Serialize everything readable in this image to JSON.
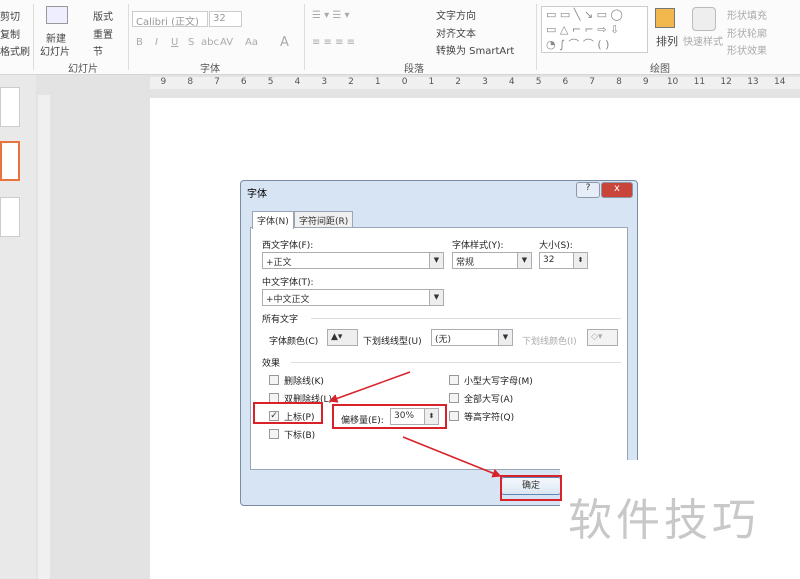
{
  "ribbon": {
    "clipboard": {
      "cut": "剪切",
      "copy": "复制",
      "format_painter": "格式刷"
    },
    "slides": {
      "new_slide": "新建",
      "new_slide2": "幻灯片",
      "layout": "版式",
      "reset": "重置",
      "section": "节",
      "label": "幻灯片"
    },
    "font": {
      "font_name": "Calibri (正文)",
      "font_size": "32",
      "bold": "B",
      "italic": "I",
      "underline": "U",
      "shadow": "S",
      "strike": "abc",
      "spacing": "AV",
      "case": "Aa",
      "color": "A",
      "label": "字体"
    },
    "paragraph": {
      "text_direction": "文字方向",
      "align_text": "对齐文本",
      "convert_smartart": "转换为 SmartArt",
      "label": "段落"
    },
    "drawing": {
      "arrange": "排列",
      "quick_styles": "快速样式",
      "shape_fill": "形状填充",
      "shape_outline": "形状轮廓",
      "shape_effects": "形状效果",
      "label": "绘图"
    }
  },
  "ruler": {
    "ticks": [
      "9",
      "8",
      "7",
      "6",
      "5",
      "4",
      "3",
      "2",
      "1",
      "0",
      "1",
      "2",
      "3",
      "4",
      "5",
      "6",
      "7",
      "8",
      "9",
      "10",
      "11",
      "12",
      "13",
      "14"
    ]
  },
  "dialog": {
    "title": "字体",
    "help": "?",
    "close": "x",
    "tabs": [
      {
        "label": "字体(N)",
        "active": true
      },
      {
        "label": "字符间距(R)",
        "active": false
      }
    ],
    "latin_font_label": "西文字体(F):",
    "latin_font_value": "+正文",
    "style_label": "字体样式(Y):",
    "style_value": "常规",
    "size_label": "大小(S):",
    "size_value": "32",
    "asian_font_label": "中文字体(T):",
    "asian_font_value": "+中文正文",
    "all_text_label": "所有文字",
    "font_color_label": "字体颜色(C)",
    "underline_style_label": "下划线线型(U)",
    "underline_style_value": "(无)",
    "underline_color_label": "下划线颜色(I)",
    "effects_label": "效果",
    "effects": [
      {
        "label": "删除线(K)",
        "checked": false
      },
      {
        "label": "双删除线(L)",
        "checked": false
      },
      {
        "label": "上标(P)",
        "checked": true
      },
      {
        "label": "下标(B)",
        "checked": false
      },
      {
        "label": "小型大写字母(M)",
        "checked": false
      },
      {
        "label": "全部大写(A)",
        "checked": false
      },
      {
        "label": "等高字符(Q)",
        "checked": false
      }
    ],
    "offset_label": "偏移量(E):",
    "offset_value": "30%",
    "ok": "确定"
  },
  "watermark": "软件技巧",
  "colors": {
    "annotation": "#d8222a",
    "selected_thumb": "#e8743b"
  }
}
